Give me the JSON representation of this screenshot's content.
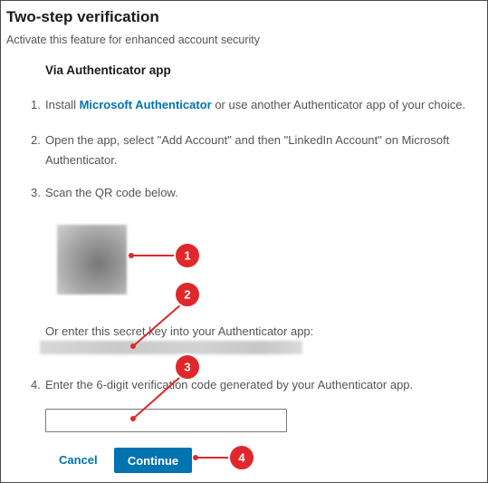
{
  "header": {
    "title": "Two-step verification",
    "subtitle": "Activate this feature for enhanced account security"
  },
  "section": {
    "title": "Via Authenticator app"
  },
  "steps": {
    "s1": {
      "num": "1.",
      "before": "Install ",
      "link": "Microsoft Authenticator",
      "after": " or use another Authenticator app of your choice."
    },
    "s2": {
      "num": "2.",
      "line1": "Open the app, select \"Add Account\" and then \"LinkedIn Account\" on Microsoft",
      "line2": "Authenticator."
    },
    "s3": {
      "num": "3.",
      "text": "Scan the QR code below."
    },
    "s4": {
      "num": "4.",
      "text": "Enter the 6-digit verification code generated by your Authenticator app."
    }
  },
  "secret": {
    "label": "Or enter this secret key into your Authenticator app:"
  },
  "code_input": {
    "value": ""
  },
  "buttons": {
    "cancel": "Cancel",
    "continue": "Continue"
  },
  "callouts": {
    "c1": "1",
    "c2": "2",
    "c3": "3",
    "c4": "4"
  },
  "colors": {
    "accent": "#0073b1",
    "callout": "#e0282c"
  }
}
